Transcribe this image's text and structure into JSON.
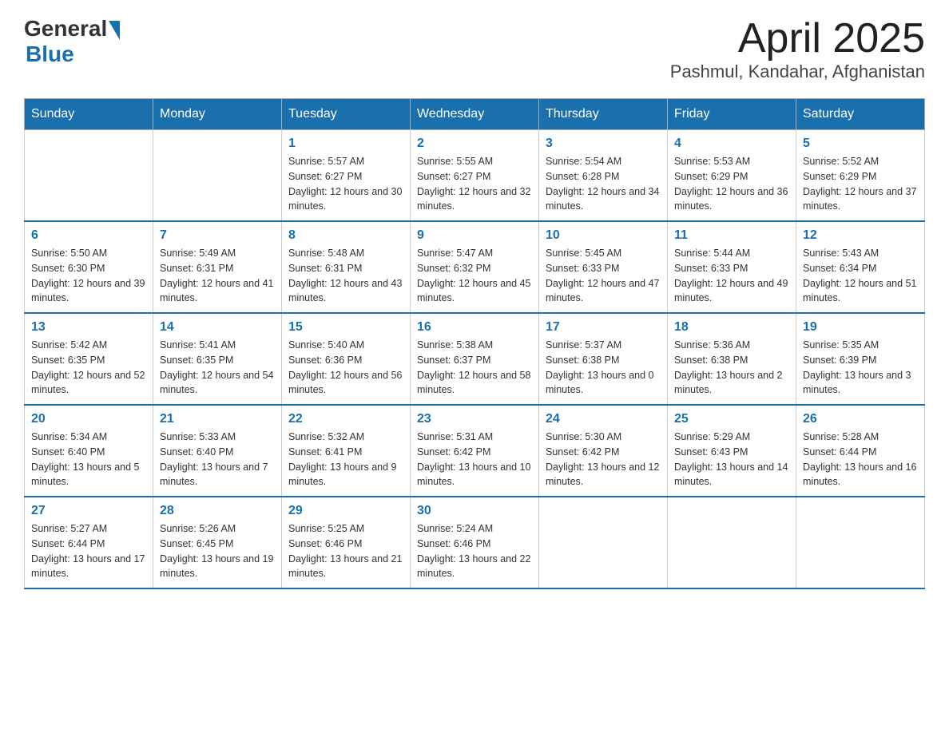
{
  "header": {
    "logo": {
      "general": "General",
      "blue": "Blue",
      "line2": "Blue"
    },
    "title": "April 2025",
    "subtitle": "Pashmul, Kandahar, Afghanistan"
  },
  "calendar": {
    "days_of_week": [
      "Sunday",
      "Monday",
      "Tuesday",
      "Wednesday",
      "Thursday",
      "Friday",
      "Saturday"
    ],
    "weeks": [
      [
        {
          "day": "",
          "sunrise": "",
          "sunset": "",
          "daylight": ""
        },
        {
          "day": "",
          "sunrise": "",
          "sunset": "",
          "daylight": ""
        },
        {
          "day": "1",
          "sunrise": "Sunrise: 5:57 AM",
          "sunset": "Sunset: 6:27 PM",
          "daylight": "Daylight: 12 hours and 30 minutes."
        },
        {
          "day": "2",
          "sunrise": "Sunrise: 5:55 AM",
          "sunset": "Sunset: 6:27 PM",
          "daylight": "Daylight: 12 hours and 32 minutes."
        },
        {
          "day": "3",
          "sunrise": "Sunrise: 5:54 AM",
          "sunset": "Sunset: 6:28 PM",
          "daylight": "Daylight: 12 hours and 34 minutes."
        },
        {
          "day": "4",
          "sunrise": "Sunrise: 5:53 AM",
          "sunset": "Sunset: 6:29 PM",
          "daylight": "Daylight: 12 hours and 36 minutes."
        },
        {
          "day": "5",
          "sunrise": "Sunrise: 5:52 AM",
          "sunset": "Sunset: 6:29 PM",
          "daylight": "Daylight: 12 hours and 37 minutes."
        }
      ],
      [
        {
          "day": "6",
          "sunrise": "Sunrise: 5:50 AM",
          "sunset": "Sunset: 6:30 PM",
          "daylight": "Daylight: 12 hours and 39 minutes."
        },
        {
          "day": "7",
          "sunrise": "Sunrise: 5:49 AM",
          "sunset": "Sunset: 6:31 PM",
          "daylight": "Daylight: 12 hours and 41 minutes."
        },
        {
          "day": "8",
          "sunrise": "Sunrise: 5:48 AM",
          "sunset": "Sunset: 6:31 PM",
          "daylight": "Daylight: 12 hours and 43 minutes."
        },
        {
          "day": "9",
          "sunrise": "Sunrise: 5:47 AM",
          "sunset": "Sunset: 6:32 PM",
          "daylight": "Daylight: 12 hours and 45 minutes."
        },
        {
          "day": "10",
          "sunrise": "Sunrise: 5:45 AM",
          "sunset": "Sunset: 6:33 PM",
          "daylight": "Daylight: 12 hours and 47 minutes."
        },
        {
          "day": "11",
          "sunrise": "Sunrise: 5:44 AM",
          "sunset": "Sunset: 6:33 PM",
          "daylight": "Daylight: 12 hours and 49 minutes."
        },
        {
          "day": "12",
          "sunrise": "Sunrise: 5:43 AM",
          "sunset": "Sunset: 6:34 PM",
          "daylight": "Daylight: 12 hours and 51 minutes."
        }
      ],
      [
        {
          "day": "13",
          "sunrise": "Sunrise: 5:42 AM",
          "sunset": "Sunset: 6:35 PM",
          "daylight": "Daylight: 12 hours and 52 minutes."
        },
        {
          "day": "14",
          "sunrise": "Sunrise: 5:41 AM",
          "sunset": "Sunset: 6:35 PM",
          "daylight": "Daylight: 12 hours and 54 minutes."
        },
        {
          "day": "15",
          "sunrise": "Sunrise: 5:40 AM",
          "sunset": "Sunset: 6:36 PM",
          "daylight": "Daylight: 12 hours and 56 minutes."
        },
        {
          "day": "16",
          "sunrise": "Sunrise: 5:38 AM",
          "sunset": "Sunset: 6:37 PM",
          "daylight": "Daylight: 12 hours and 58 minutes."
        },
        {
          "day": "17",
          "sunrise": "Sunrise: 5:37 AM",
          "sunset": "Sunset: 6:38 PM",
          "daylight": "Daylight: 13 hours and 0 minutes."
        },
        {
          "day": "18",
          "sunrise": "Sunrise: 5:36 AM",
          "sunset": "Sunset: 6:38 PM",
          "daylight": "Daylight: 13 hours and 2 minutes."
        },
        {
          "day": "19",
          "sunrise": "Sunrise: 5:35 AM",
          "sunset": "Sunset: 6:39 PM",
          "daylight": "Daylight: 13 hours and 3 minutes."
        }
      ],
      [
        {
          "day": "20",
          "sunrise": "Sunrise: 5:34 AM",
          "sunset": "Sunset: 6:40 PM",
          "daylight": "Daylight: 13 hours and 5 minutes."
        },
        {
          "day": "21",
          "sunrise": "Sunrise: 5:33 AM",
          "sunset": "Sunset: 6:40 PM",
          "daylight": "Daylight: 13 hours and 7 minutes."
        },
        {
          "day": "22",
          "sunrise": "Sunrise: 5:32 AM",
          "sunset": "Sunset: 6:41 PM",
          "daylight": "Daylight: 13 hours and 9 minutes."
        },
        {
          "day": "23",
          "sunrise": "Sunrise: 5:31 AM",
          "sunset": "Sunset: 6:42 PM",
          "daylight": "Daylight: 13 hours and 10 minutes."
        },
        {
          "day": "24",
          "sunrise": "Sunrise: 5:30 AM",
          "sunset": "Sunset: 6:42 PM",
          "daylight": "Daylight: 13 hours and 12 minutes."
        },
        {
          "day": "25",
          "sunrise": "Sunrise: 5:29 AM",
          "sunset": "Sunset: 6:43 PM",
          "daylight": "Daylight: 13 hours and 14 minutes."
        },
        {
          "day": "26",
          "sunrise": "Sunrise: 5:28 AM",
          "sunset": "Sunset: 6:44 PM",
          "daylight": "Daylight: 13 hours and 16 minutes."
        }
      ],
      [
        {
          "day": "27",
          "sunrise": "Sunrise: 5:27 AM",
          "sunset": "Sunset: 6:44 PM",
          "daylight": "Daylight: 13 hours and 17 minutes."
        },
        {
          "day": "28",
          "sunrise": "Sunrise: 5:26 AM",
          "sunset": "Sunset: 6:45 PM",
          "daylight": "Daylight: 13 hours and 19 minutes."
        },
        {
          "day": "29",
          "sunrise": "Sunrise: 5:25 AM",
          "sunset": "Sunset: 6:46 PM",
          "daylight": "Daylight: 13 hours and 21 minutes."
        },
        {
          "day": "30",
          "sunrise": "Sunrise: 5:24 AM",
          "sunset": "Sunset: 6:46 PM",
          "daylight": "Daylight: 13 hours and 22 minutes."
        },
        {
          "day": "",
          "sunrise": "",
          "sunset": "",
          "daylight": ""
        },
        {
          "day": "",
          "sunrise": "",
          "sunset": "",
          "daylight": ""
        },
        {
          "day": "",
          "sunrise": "",
          "sunset": "",
          "daylight": ""
        }
      ]
    ]
  }
}
